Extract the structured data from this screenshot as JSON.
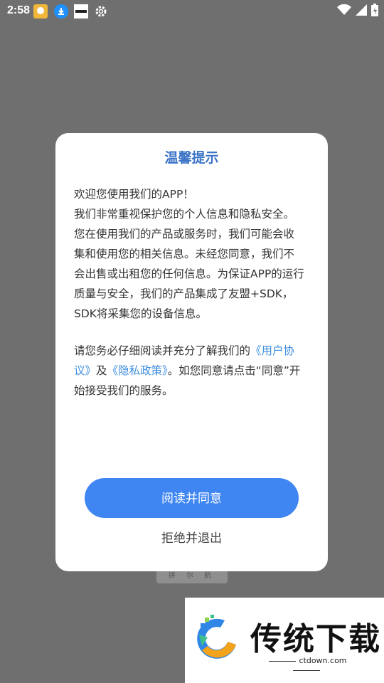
{
  "status_bar": {
    "time": "2:58",
    "left_icons": [
      "app-notification-icon",
      "download-icon",
      "tv-app-icon",
      "gear-icon"
    ],
    "right_icons": [
      "wifi-icon",
      "signal-icon",
      "battery-charging-icon"
    ]
  },
  "dialog": {
    "title": "温馨提示",
    "paragraph1": "欢迎您使用我们的APP！\n我们非常重视保护您的个人信息和隐私安全。您在使用我们的产品或服务时，我们可能会收集和使用您的相关信息。未经您同意，我们不会出售或出租您的任何信息。为保证APP的运行质量与安全，我们的产品集成了友盟+SDK，SDK将采集您的设备信息。",
    "paragraph2_before": "请您务必仔细阅读并充分了解我们的",
    "user_agreement_link": "《用户协议》",
    "and": "及",
    "privacy_policy_link": "《隐私政策》",
    "paragraph2_after": "。如您同意请点击“同意”开始接受我们的服务。",
    "agree_button": "阅读并同意",
    "reject_button": "拒绝并退出"
  },
  "background": {
    "bottom_bar_text": "拼 尔 航"
  },
  "watermark": {
    "brand": "传统下载",
    "url": "ctdown.com"
  },
  "colors": {
    "overlay": "#6f6f6f",
    "title": "#3a73c6",
    "link": "#3e8ee0",
    "button": "#3f86f2"
  }
}
